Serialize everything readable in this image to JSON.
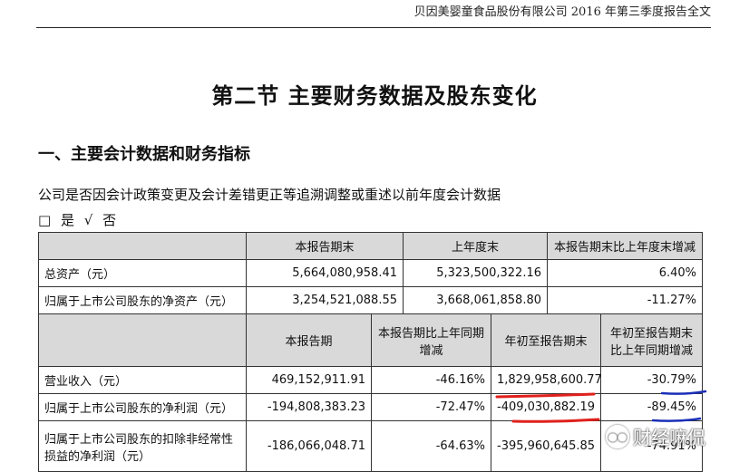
{
  "header": {
    "text": "贝因美婴童食品股份有限公司 2016 年第三季度报告全文"
  },
  "section_title": "第二节  主要财务数据及股东变化",
  "heading1": "一、主要会计数据和财务指标",
  "note": "公司是否因会计政策变更及会计差错更正等追溯调整或重述以前年度会计数据",
  "choice": {
    "yes_box": "□",
    "yes_label": "是",
    "no_mark": "√",
    "no_label": "否"
  },
  "table1": {
    "headers": [
      "",
      "本报告期末",
      "上年度末",
      "本报告期末比上年度末增减"
    ],
    "rows": [
      [
        "总资产（元）",
        "5,664,080,958.41",
        "5,323,500,322.16",
        "6.40%"
      ],
      [
        "归属于上市公司股东的净资产（元）",
        "3,254,521,088.55",
        "3,668,061,858.80",
        "-11.27%"
      ]
    ]
  },
  "table2": {
    "headers": [
      "",
      "本报告期",
      "本报告期比上年同期增减",
      "年初至报告期末",
      "年初至报告期末比上年同期增减"
    ],
    "rows": [
      [
        "营业收入（元）",
        "469,152,911.91",
        "-46.16%",
        "1,829,958,600.77",
        "-30.79%"
      ],
      [
        "归属于上市公司股东的净利润（元）",
        "-194,808,383.23",
        "-72.47%",
        "-409,030,882.19",
        "-89.45%"
      ],
      [
        "归属于上市公司股东的扣除非经常性损益的净利润（元）",
        "-186,066,048.71",
        "-64.63%",
        "-395,960,645.85",
        "-74.91%"
      ]
    ]
  },
  "annotations": {
    "underline_color_red": "#e0201c",
    "underline_color_blue": "#1a2fb8"
  },
  "watermark": {
    "icon": "wechat-icon",
    "text": "财经嘛侃"
  }
}
